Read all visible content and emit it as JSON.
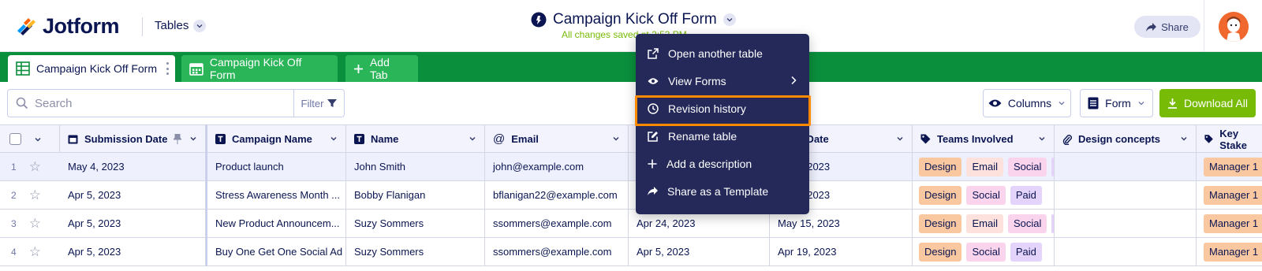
{
  "header": {
    "logo_text": "Jotform",
    "tables_label": "Tables",
    "title": "Campaign Kick Off Form",
    "saved_status": "All changes saved at 2:53 PM",
    "share_label": "Share"
  },
  "tabs": [
    {
      "label": "Campaign Kick Off Form",
      "active": true
    },
    {
      "label": "Campaign Kick Off Form",
      "active": false
    },
    {
      "label": "Add Tab",
      "active": false
    }
  ],
  "toolbar": {
    "search_placeholder": "Search",
    "filter_label": "Filter",
    "columns_label": "Columns",
    "form_label": "Form",
    "download_label": "Download All"
  },
  "menu": {
    "items": [
      {
        "label": "Open another table",
        "icon": "external-link-icon"
      },
      {
        "label": "View Forms",
        "icon": "eye-icon",
        "has_submenu": true
      },
      {
        "label": "Revision history",
        "icon": "clock-icon",
        "highlighted": true
      },
      {
        "label": "Rename table",
        "icon": "edit-icon"
      },
      {
        "label": "Add a description",
        "icon": "plus-icon"
      },
      {
        "label": "Share as a Template",
        "icon": "share-icon"
      }
    ]
  },
  "table": {
    "columns": [
      {
        "label": "Submission Date",
        "icon": "calendar-icon"
      },
      {
        "label": "Campaign Name",
        "icon": "text-icon"
      },
      {
        "label": "Name",
        "icon": "text-icon"
      },
      {
        "label": "Email",
        "icon": "at-icon"
      },
      {
        "label": "d Date",
        "icon": "calendar-icon"
      },
      {
        "label": "Teams Involved",
        "icon": "tag-icon"
      },
      {
        "label": "Design concepts",
        "icon": "paperclip-icon"
      },
      {
        "label": "Key Stake",
        "icon": "tag-icon"
      }
    ],
    "rows": [
      {
        "num": "1",
        "submission_date": "May 4, 2023",
        "campaign": "Product launch",
        "name": "John Smith",
        "email": "john@example.com",
        "date2": "",
        "end_date": ", 2023",
        "teams": [
          "Design",
          "Email",
          "Social"
        ],
        "teams_more": true,
        "stake": "Manager 1"
      },
      {
        "num": "2",
        "submission_date": "Apr 5, 2023",
        "campaign": "Stress Awareness Month ...",
        "name": "Bobby Flanigan",
        "email": "bflanigan22@example.com",
        "date2": "",
        "end_date": ", 2023",
        "teams": [
          "Design",
          "Social",
          "Paid"
        ],
        "teams_more": false,
        "stake": "Manager 1"
      },
      {
        "num": "3",
        "submission_date": "Apr 5, 2023",
        "campaign": "New Product Announcem...",
        "name": "Suzy Sommers",
        "email": "ssommers@example.com",
        "date2": "Apr 24, 2023",
        "end_date": "May 15, 2023",
        "teams": [
          "Design",
          "Email",
          "Social"
        ],
        "teams_more": true,
        "stake": "Manager 1"
      },
      {
        "num": "4",
        "submission_date": "Apr 5, 2023",
        "campaign": "Buy One Get One Social Ad",
        "name": "Suzy Sommers",
        "email": "ssommers@example.com",
        "date2": "Apr 5, 2023",
        "end_date": "Apr 19, 2023",
        "teams": [
          "Design",
          "Social",
          "Paid"
        ],
        "teams_more": false,
        "stake": "Manager 1"
      }
    ]
  },
  "colors": {
    "tabbar": "#0a8f3d",
    "tab_inactive": "#2bb559",
    "menu_bg": "#24295a",
    "highlight": "#ff8a00",
    "download": "#78bb07"
  }
}
